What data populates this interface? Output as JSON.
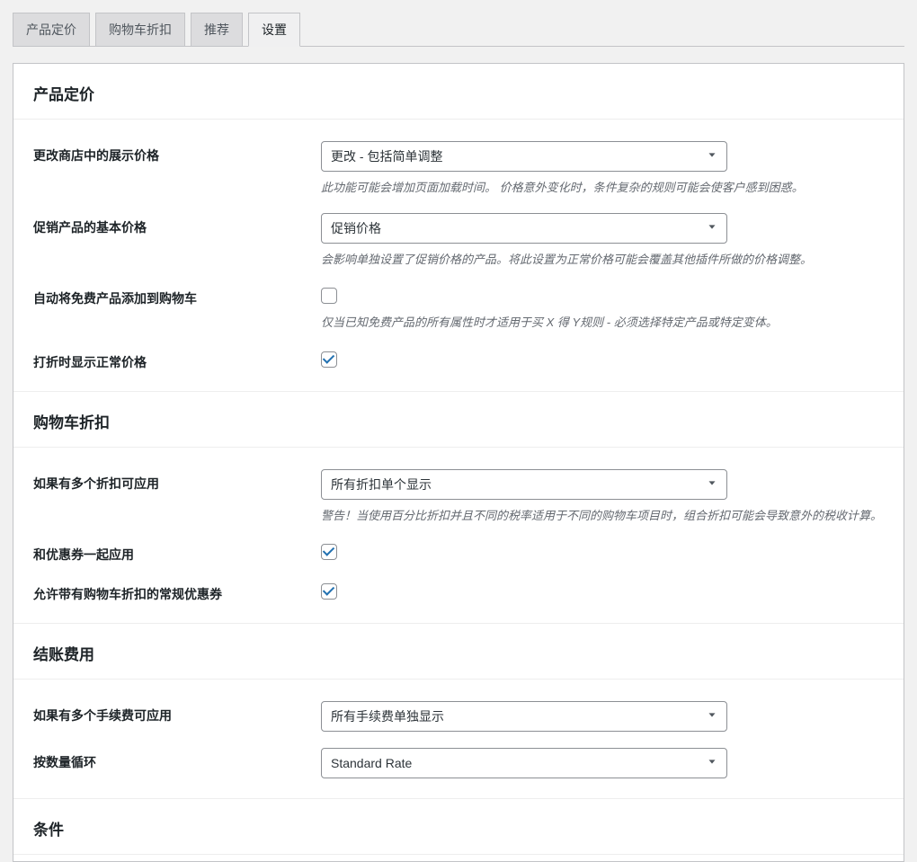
{
  "tabs": [
    {
      "label": "产品定价"
    },
    {
      "label": "购物车折扣"
    },
    {
      "label": "推荐"
    },
    {
      "label": "设置"
    }
  ],
  "activeTab": 3,
  "sections": {
    "pricing": {
      "title": "产品定价",
      "display_price": {
        "label": "更改商店中的展示价格",
        "value": "更改 - 包括简单调整",
        "help": "此功能可能会增加页面加载时间。 价格意外变化时，条件复杂的规则可能会使客户感到困惑。"
      },
      "base_price": {
        "label": "促销产品的基本价格",
        "value": "促销价格",
        "help": "会影响单独设置了促销价格的产品。将此设置为正常价格可能会覆盖其他插件所做的价格调整。"
      },
      "free_products": {
        "label": "自动将免费产品添加到购物车",
        "help": "仅当已知免费产品的所有属性时才适用于买 X 得 Y规则 - 必须选择特定产品或特定变体。"
      },
      "show_regular": {
        "label": "打折时显示正常价格"
      }
    },
    "cart": {
      "title": "购物车折扣",
      "multiple": {
        "label": "如果有多个折扣可应用",
        "value": "所有折扣单个显示",
        "help": "警告！当使用百分比折扣并且不同的税率适用于不同的购物车项目时，组合折扣可能会导致意外的税收计算。"
      },
      "coupons": {
        "label": "和优惠券一起应用"
      },
      "regular_coupons": {
        "label": "允许带有购物车折扣的常规优惠券"
      }
    },
    "checkout": {
      "title": "结账费用",
      "multiple_fees": {
        "label": "如果有多个手续费可应用",
        "value": "所有手续费单独显示"
      },
      "qty_loop": {
        "label": "按数量循环",
        "value": "Standard Rate"
      }
    },
    "conditions": {
      "title": "条件"
    }
  }
}
